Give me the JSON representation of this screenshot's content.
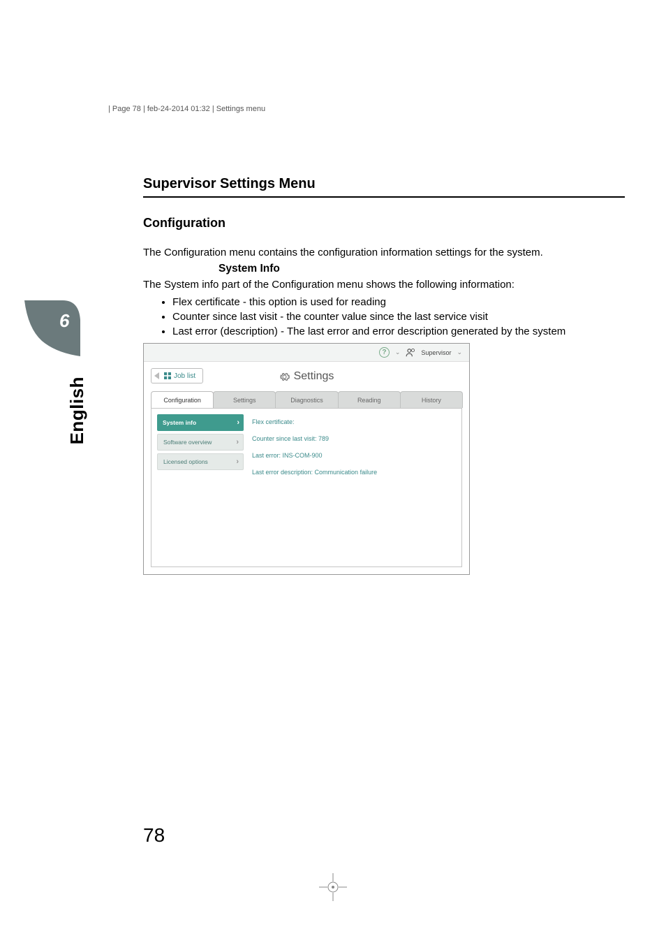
{
  "header": "| Page 78 | feb-24-2014 01:32 | Settings menu",
  "section_title": "Supervisor Settings Menu",
  "subsection_title": "Configuration",
  "intro": "The Configuration menu contains the configuration information settings for the system.",
  "system_info_heading": "System Info",
  "system_info_desc": "The System info part of the Configuration menu shows the following information:",
  "bullets": [
    "Flex certificate - this option is used for reading",
    "Counter since last visit - the counter value since the last service visit",
    "Last error (description) - The last error and error description generated by the system"
  ],
  "side_tab": {
    "chapter": "6",
    "language": "English"
  },
  "screenshot": {
    "topbar": {
      "user_label": "Supervisor"
    },
    "joblist_label": "Job list",
    "title": "Settings",
    "tabs": [
      "Configuration",
      "Settings",
      "Diagnostics",
      "Reading",
      "History"
    ],
    "active_tab_index": 0,
    "side_items": [
      {
        "label": "System info",
        "active": true
      },
      {
        "label": "Software overview",
        "active": false
      },
      {
        "label": "Licensed options",
        "active": false
      }
    ],
    "detail_rows": [
      "Flex certificate:",
      "Counter since last visit:  789",
      "Last error: INS-COM-900",
      "Last error description: Communication failure"
    ]
  },
  "page_number": "78"
}
